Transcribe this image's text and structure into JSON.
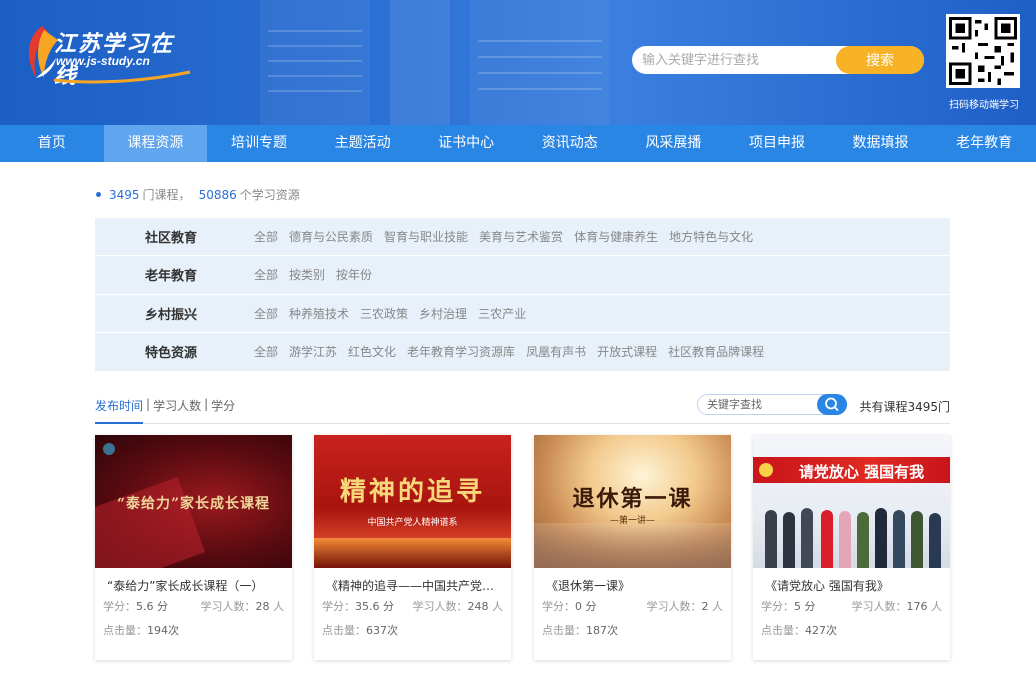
{
  "header": {
    "logo_title": "江苏学习在线",
    "logo_url": "www.js-study.cn",
    "search_placeholder": "输入关键字进行查找",
    "search_button": "搜索",
    "qr_caption": "扫码移动端学习"
  },
  "nav": {
    "items": [
      "首页",
      "课程资源",
      "培训专题",
      "主题活动",
      "证书中心",
      "资讯动态",
      "风采展播",
      "项目申报",
      "数据填报",
      "老年教育"
    ],
    "active_index": 1
  },
  "stats": {
    "courses": "3495",
    "courses_label": "门课程，",
    "resources": "50886",
    "resources_label": "个学习资源"
  },
  "filters": [
    {
      "label": "社区教育",
      "options": [
        "全部",
        "德育与公民素质",
        "智育与职业技能",
        "美育与艺术鉴赏",
        "体育与健康养生",
        "地方特色与文化"
      ]
    },
    {
      "label": "老年教育",
      "options": [
        "全部",
        "按类别",
        "按年份"
      ]
    },
    {
      "label": "乡村振兴",
      "options": [
        "全部",
        "种养殖技术",
        "三农政策",
        "乡村治理",
        "三农产业"
      ]
    },
    {
      "label": "特色资源",
      "options": [
        "全部",
        "游学江苏",
        "红色文化",
        "老年教育学习资源库",
        "凤凰有声书",
        "开放式课程",
        "社区教育品牌课程"
      ]
    }
  ],
  "sort": {
    "tabs": [
      "发布时间",
      "学习人数",
      "学分"
    ],
    "active_index": 0,
    "keyword_placeholder": "关键字查找",
    "total_label": "共有课程3495门"
  },
  "labels": {
    "credit": "学分：",
    "learners": "学习人数：",
    "learners_unit": "人",
    "clicks": "点击量：",
    "clicks_unit": "次"
  },
  "courses": [
    {
      "title": "“泰给力”家长成长课程（一）",
      "credit": "5.6 分",
      "learners": "28",
      "clicks": "194",
      "thumb_text": "“泰给力”家长成长课程"
    },
    {
      "title": "《精神的追寻——中国共产党人...",
      "credit": "35.6 分",
      "learners": "248",
      "clicks": "637",
      "thumb_text": "精神的追寻",
      "thumb_sub": "中国共产党人精神谱系"
    },
    {
      "title": "《退休第一课》",
      "credit": "0 分",
      "learners": "2",
      "clicks": "187",
      "thumb_text": "退休第一课",
      "thumb_sub": "—第一讲—"
    },
    {
      "title": "《请党放心 强国有我》",
      "credit": "5 分",
      "learners": "176",
      "clicks": "427",
      "thumb_text": "请党放心 强国有我"
    }
  ],
  "colors": {
    "brand": "#2a6fd3",
    "nav": "#2a86e4",
    "nav_active": "#5fa6ee",
    "search_button": "#f7b325",
    "filter_bg": "#e8f1fa"
  }
}
